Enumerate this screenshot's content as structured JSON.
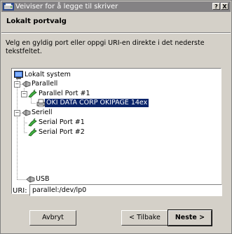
{
  "window": {
    "title": "Veiviser for å legge til skriver",
    "help_button": "?",
    "close_button": "X"
  },
  "header": {
    "title": "Lokalt portvalg"
  },
  "description": "Velg en gyldig port eller oppgi URI-en direkte i det nederste tekstfeltet.",
  "tree": {
    "root": "Lokalt system",
    "parallel": "Parallell",
    "parallel_port_1": "Parallel Port #1",
    "printer": "OKI DATA CORP OKIPAGE 14ex",
    "serial": "Seriell",
    "serial_port_1": "Serial Port #1",
    "serial_port_2": "Serial Port #2",
    "usb": "USB",
    "expander_parallel": "−",
    "expander_port": "−",
    "expander_serial": "−"
  },
  "uri": {
    "label": "URI:",
    "value": "parallel:/dev/lp0"
  },
  "buttons": {
    "cancel": "Avbryt",
    "back": "< Tilbake",
    "next": "Neste >"
  }
}
